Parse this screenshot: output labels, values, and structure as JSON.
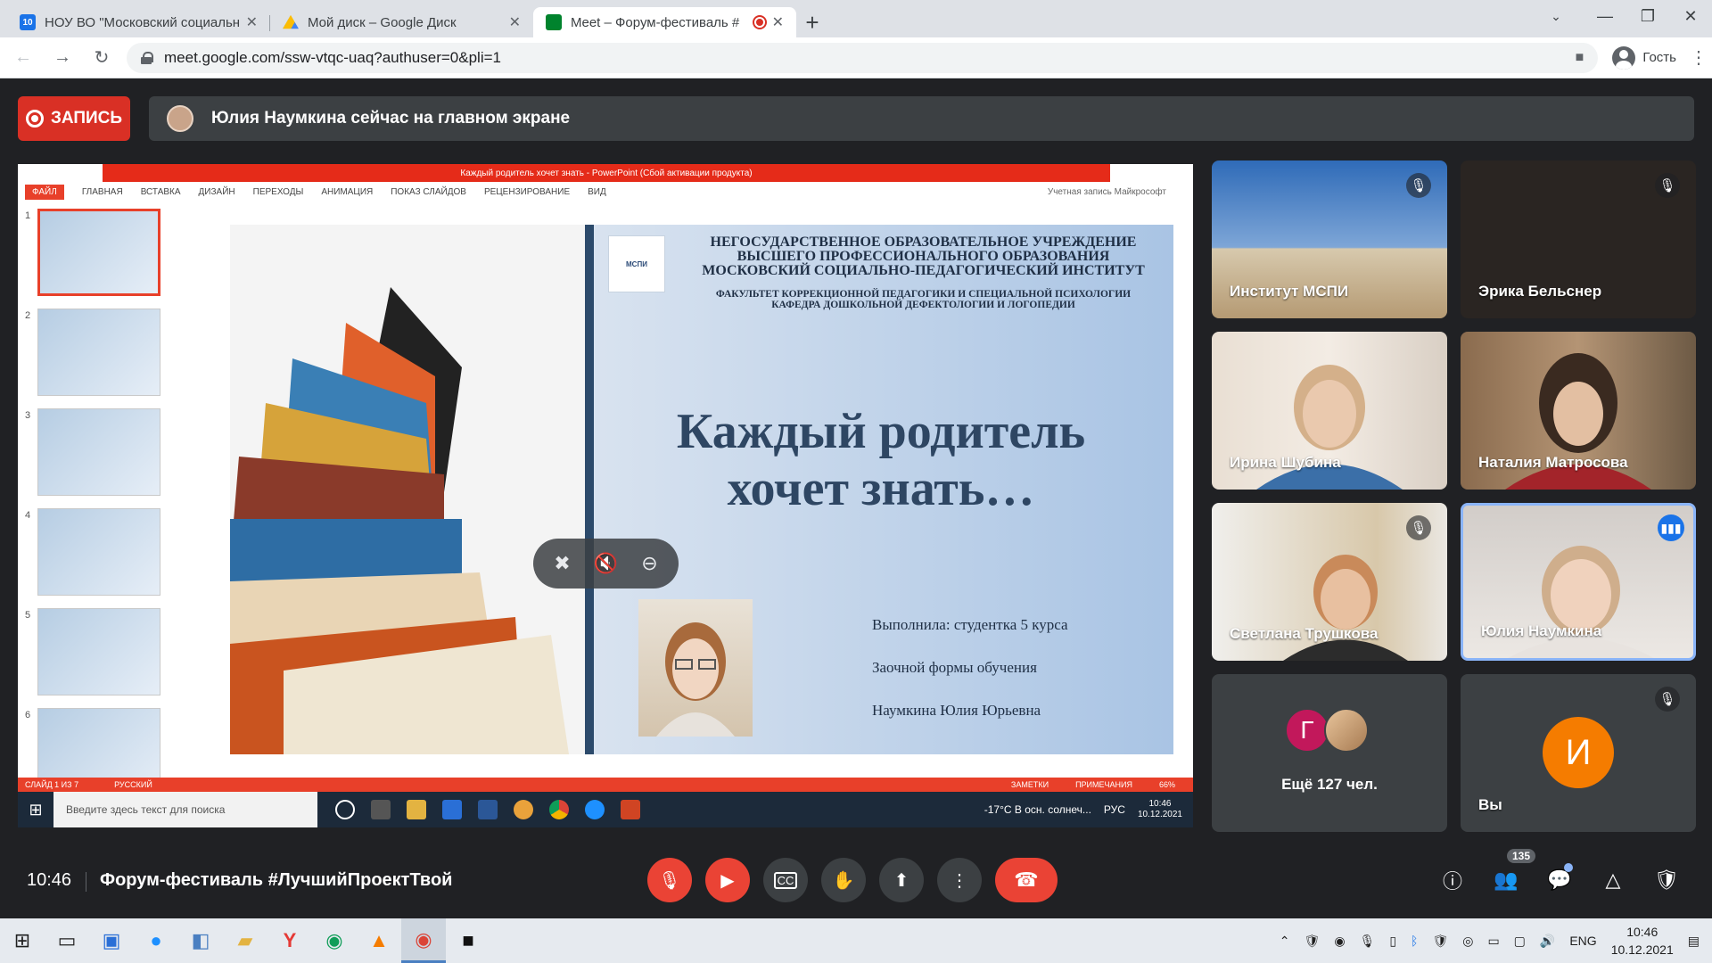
{
  "browser": {
    "tabs": [
      {
        "title": "НОУ ВО \"Московский социальн",
        "favicon": "10",
        "favicon_color": "#1a73e8"
      },
      {
        "title": "Мой диск – Google Диск",
        "favicon": "drive",
        "favicon_color": "#fbbc04"
      },
      {
        "title": "Meet – Форум-фестиваль #",
        "favicon": "meet",
        "favicon_color": "#00832d",
        "recording": true
      }
    ],
    "url": "meet.google.com/ssw-vtqc-uaq?authuser=0&pli=1",
    "profile_label": "Гость"
  },
  "meet": {
    "record_label": "ЗАПИСЬ",
    "banner_text": "Юлия Наумкина сейчас на главном экране",
    "participants": [
      {
        "name": "Институт МСПИ",
        "muted": true
      },
      {
        "name": "Эрика Бельснер",
        "muted": true
      },
      {
        "name": "Ирина Шубина",
        "muted": false
      },
      {
        "name": "Наталия Матросова",
        "muted": false
      },
      {
        "name": "Светлана Трушкова",
        "muted": true
      },
      {
        "name": "Юлия Наумкина",
        "muted": false,
        "speaking": true
      }
    ],
    "more": {
      "label": "Ещё 127 чел.",
      "avatar_letter": "Г"
    },
    "self": {
      "name": "Вы",
      "avatar_letter": "И"
    },
    "clock": "10:46",
    "meeting_title": "Форум-фестиваль #ЛучшийПроектТвой",
    "people_count": "135"
  },
  "presentation": {
    "window_title": "Каждый родитель хочет знать - PowerPoint (Сбой активации продукта)",
    "ribbon": [
      "ФАЙЛ",
      "ГЛАВНАЯ",
      "ВСТАВКА",
      "ДИЗАЙН",
      "ПЕРЕХОДЫ",
      "АНИМАЦИЯ",
      "ПОКАЗ СЛАЙДОВ",
      "РЕЦЕНЗИРОВАНИЕ",
      "ВИД"
    ],
    "account": "Учетная запись Майкрософт",
    "slide_numbers": [
      "1",
      "2",
      "3",
      "4",
      "5",
      "6"
    ],
    "logo_text": "МСПИ",
    "org_lines": [
      "НЕГОСУДАРСТВЕННОЕ ОБРАЗОВАТЕЛЬНОЕ УЧРЕЖДЕНИЕ",
      "ВЫСШЕГО ПРОФЕССИОНАЛЬНОГО ОБРАЗОВАНИЯ",
      "МОСКОВСКИЙ СОЦИАЛЬНО-ПЕДАГОГИЧЕСКИЙ ИНСТИТУТ"
    ],
    "faculty_lines": [
      "ФАКУЛЬТЕТ КОРРЕКЦИОННОЙ ПЕДАГОГИКИ И СПЕЦИАЛЬНОЙ ПСИХОЛОГИИ",
      "КАФЕДРА ДОШКОЛЬНОЙ ДЕФЕКТОЛОГИИ И ЛОГОПЕДИИ"
    ],
    "title_lines": [
      "Каждый родитель",
      "хочет знать…"
    ],
    "author_lines": [
      "Выполнила: студентка 5 курса",
      "Заочной формы обучения",
      "Наумкина Юлия Юрьевна"
    ],
    "status_left": "СЛАЙД 1 ИЗ 7",
    "status_lang": "РУССКИЙ",
    "status_notes": "ЗАМЕТКИ",
    "status_comments": "ПРИМЕЧАНИЯ",
    "status_zoom": "66%",
    "inner_search": "Введите здесь текст для поиска",
    "inner_weather": "-17°C  В осн. солнеч...",
    "inner_lang": "РУС",
    "inner_time": "10:46",
    "inner_date": "10.12.2021"
  },
  "taskbar": {
    "lang": "ENG",
    "time": "10:46",
    "date": "10.12.2021"
  }
}
